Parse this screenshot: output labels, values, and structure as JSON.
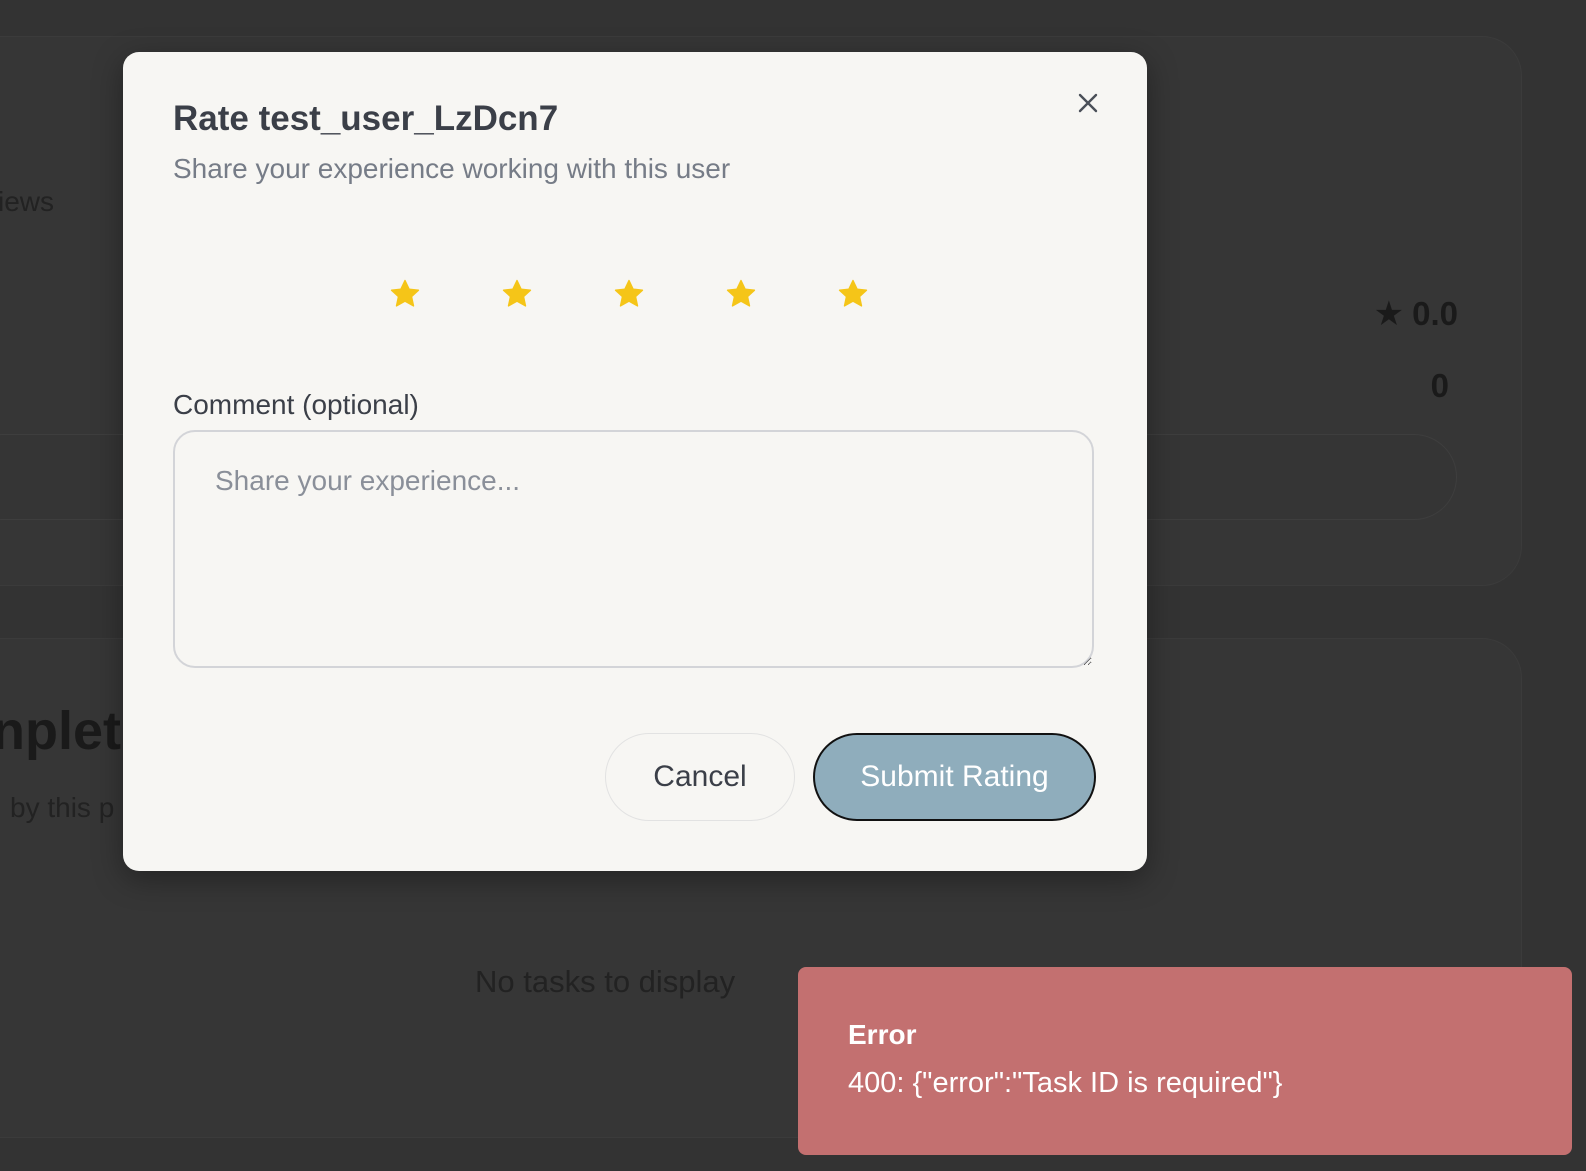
{
  "background": {
    "reviews_fragment": "iews",
    "rating_value": "0.0",
    "count_value": "0",
    "heading_fragment": "nplete",
    "subtext_fragment": "by this p",
    "empty_state": "No tasks to display"
  },
  "modal": {
    "title": "Rate test_user_LzDcn7",
    "subtitle": "Share your experience working with this user",
    "stars": {
      "count": 5,
      "selected": 5,
      "color": "#f5c518"
    },
    "comment": {
      "label": "Comment (optional)",
      "placeholder": "Share your experience...",
      "value": ""
    },
    "buttons": {
      "cancel": "Cancel",
      "submit": "Submit Rating"
    }
  },
  "toast": {
    "title": "Error",
    "message": "400: {\"error\":\"Task ID is required\"}",
    "color": "#c37070"
  }
}
